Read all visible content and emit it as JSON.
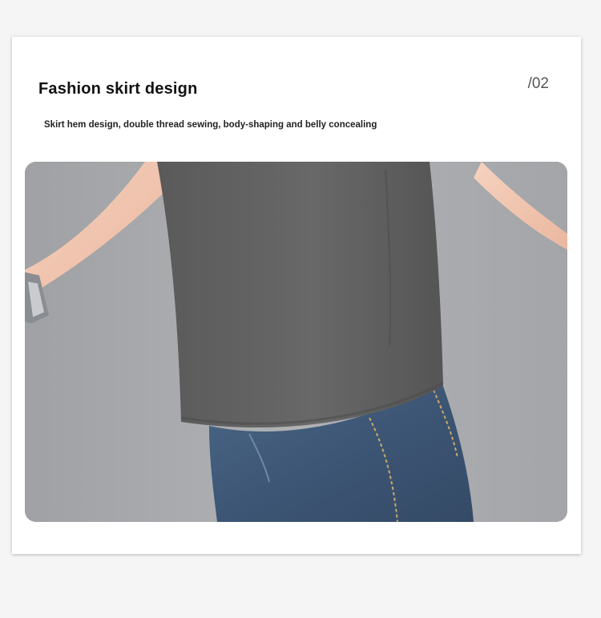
{
  "section": {
    "title": "Fashion skirt design",
    "page_number": "/02",
    "subtitle": "Skirt hem design, double thread sewing, body-shaping and belly concealing"
  },
  "photo": {
    "colors": {
      "background": "#a6a8ab",
      "shirt": "#5e5e5e",
      "skin": "#f3c9b4",
      "denim": "#3f5a78"
    }
  }
}
